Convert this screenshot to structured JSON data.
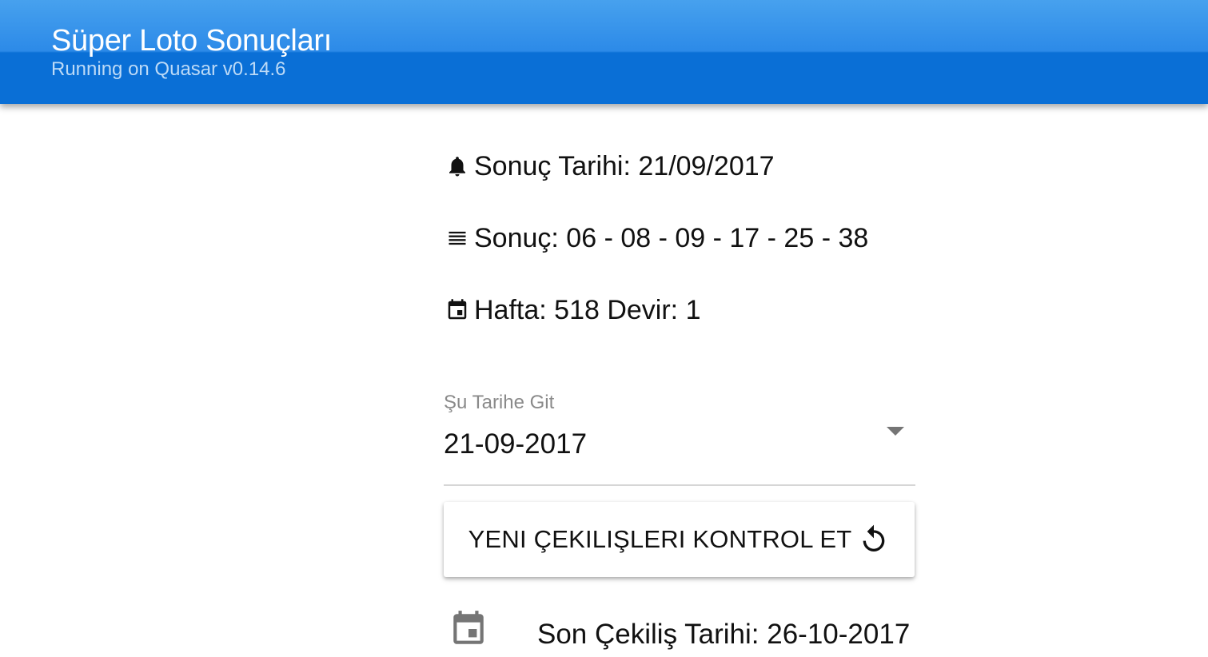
{
  "toolbar": {
    "title": "Süper Loto Sonuçları",
    "subtitle": "Running on Quasar v0.14.6"
  },
  "info": {
    "date_text": "Sonuç Tarihi: 21/09/2017",
    "result_text": "Sonuç: 06 - 08 - 09 - 17 - 25 - 38",
    "week_text": "Hafta: 518 Devir: 1",
    "icons": [
      "bell-icon",
      "list-icon",
      "calendar-icon"
    ]
  },
  "date_select": {
    "label": "Şu Tarihe Git",
    "value": "21-09-2017"
  },
  "refresh_button": {
    "label": "YENI ÇEKILIŞLERI KONTROL ET",
    "icon": "refresh-icon"
  },
  "last_draw": {
    "text": "Son Çekiliş Tarihi: 26-10-2017",
    "icon": "calendar-icon"
  },
  "colors": {
    "toolbar": "#0a6fd6",
    "toolbar_light": "#47a1ee"
  }
}
